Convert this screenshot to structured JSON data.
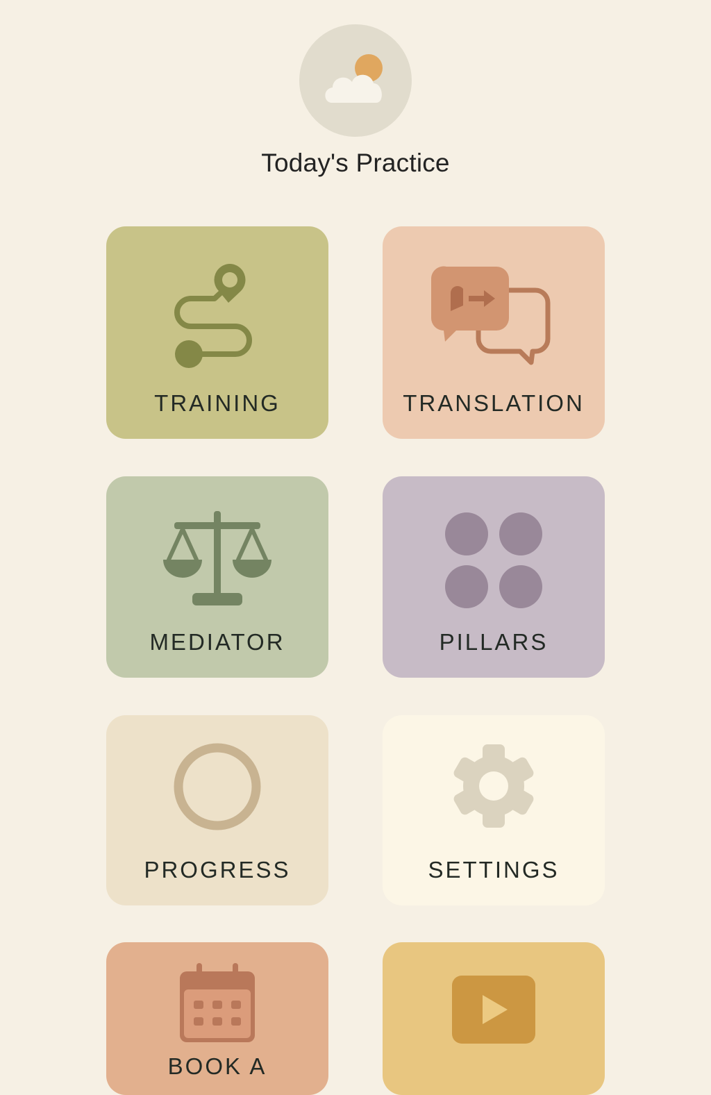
{
  "header": {
    "weather_icon": "cloud-sun-icon",
    "title": "Today's Practice"
  },
  "tiles": [
    {
      "id": "training",
      "label": "TRAINING",
      "icon": "route-path-icon",
      "color": "#c8c388"
    },
    {
      "id": "translation",
      "label": "TRANSLATION",
      "icon": "chat-bubbles-icon",
      "color": "#edcab0"
    },
    {
      "id": "mediator",
      "label": "MEDIATOR",
      "icon": "scales-icon",
      "color": "#c1c9ab"
    },
    {
      "id": "pillars",
      "label": "PILLARS",
      "icon": "four-dots-icon",
      "color": "#c7bbc6"
    },
    {
      "id": "progress",
      "label": "PROGRESS",
      "icon": "ring-icon",
      "color": "#ede1c9"
    },
    {
      "id": "settings",
      "label": "SETTINGS",
      "icon": "gear-icon",
      "color": "#fcf6e6"
    },
    {
      "id": "book",
      "label": "BOOK A",
      "icon": "calendar-icon",
      "color": "#e2b08e"
    },
    {
      "id": "video",
      "label": "",
      "icon": "play-video-icon",
      "color": "#e8c680"
    }
  ]
}
